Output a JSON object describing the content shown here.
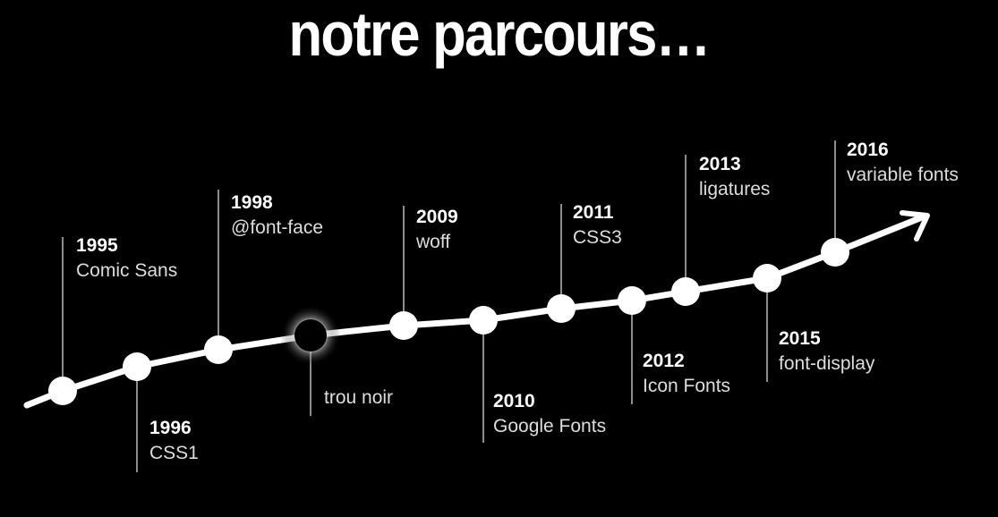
{
  "title": "notre parcours…",
  "events": [
    {
      "year": "1995",
      "label": "Comic Sans",
      "kind": "normal"
    },
    {
      "year": "1996",
      "label": "CSS1",
      "kind": "normal"
    },
    {
      "year": "1998",
      "label": "@font-face",
      "kind": "normal"
    },
    {
      "year": "",
      "label": "trou noir",
      "kind": "black-hole"
    },
    {
      "year": "2009",
      "label": "woff",
      "kind": "normal"
    },
    {
      "year": "2010",
      "label": "Google Fonts",
      "kind": "normal"
    },
    {
      "year": "2011",
      "label": "CSS3",
      "kind": "normal"
    },
    {
      "year": "2012",
      "label": "Icon Fonts",
      "kind": "normal"
    },
    {
      "year": "2013",
      "label": "ligatures",
      "kind": "normal"
    },
    {
      "year": "2015",
      "label": "font-display",
      "kind": "normal"
    },
    {
      "year": "2016",
      "label": "variable fonts",
      "kind": "normal"
    }
  ],
  "colors": {
    "background": "#000000",
    "line": "#ffffff",
    "leader": "#bbbbbb"
  }
}
